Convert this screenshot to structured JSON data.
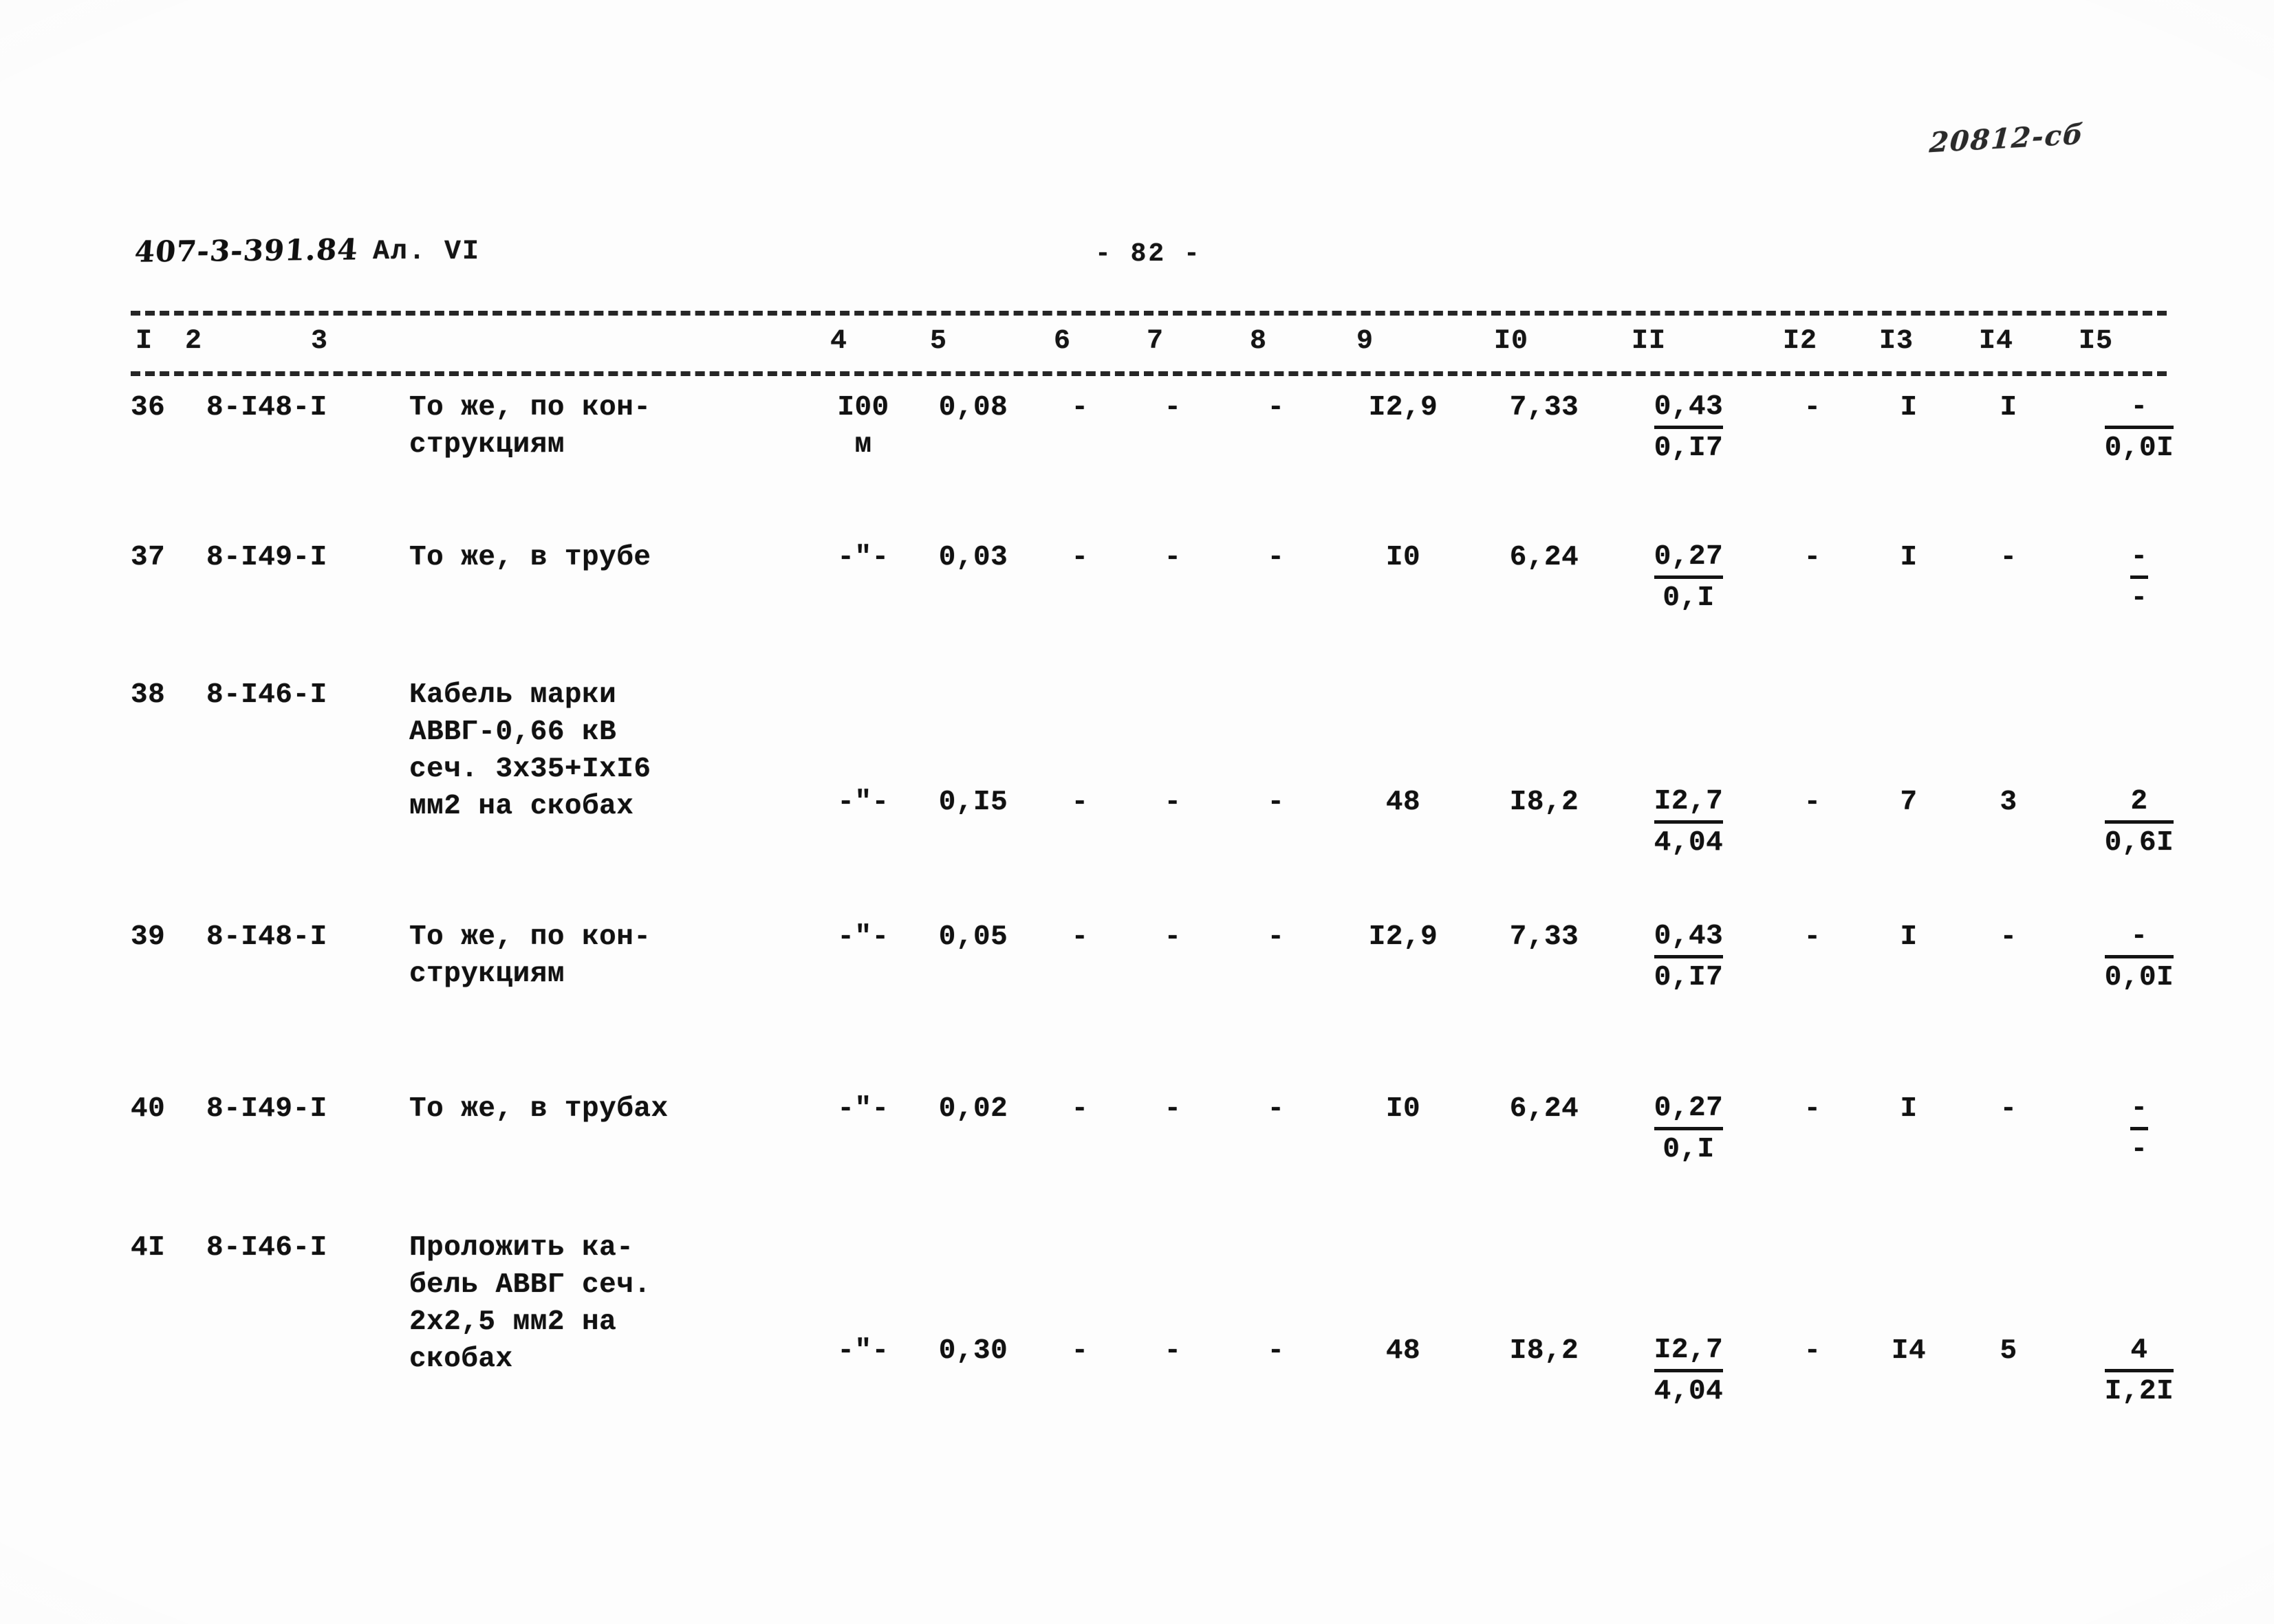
{
  "page": {
    "handwritten_code": "20812-сб",
    "document_code": "407-3-391.84",
    "album_label": "Ал. VI",
    "page_number": "- 82 -"
  },
  "table": {
    "column_numbers": [
      "I",
      "2",
      "3",
      "4",
      "5",
      "6",
      "7",
      "8",
      "9",
      "I0",
      "II",
      "I2",
      "I3",
      "I4",
      "I5"
    ],
    "rows": [
      {
        "num": "36",
        "code": "8-I48-I",
        "desc": "То же, по кон-\nструкциям",
        "unit_top": "I00",
        "unit_bot": "м",
        "c5": "0,08",
        "c6": "-",
        "c7": "-",
        "c8": "-",
        "c9": "I2,9",
        "c10": "7,33",
        "c11_top": "0,43",
        "c11_bot": "0,I7",
        "c12": "-",
        "c13": "I",
        "c14": "I",
        "c15_top": "-",
        "c15_bot": "0,0I"
      },
      {
        "num": "37",
        "code": "8-I49-I",
        "desc": "То же, в трубе",
        "unit_top": "-\"-",
        "unit_bot": "",
        "c5": "0,03",
        "c6": "-",
        "c7": "-",
        "c8": "-",
        "c9": "I0",
        "c10": "6,24",
        "c11_top": "0,27",
        "c11_bot": "0,I",
        "c12": "-",
        "c13": "I",
        "c14": "-",
        "c15_top": "-",
        "c15_bot": "-"
      },
      {
        "num": "38",
        "code": "8-I46-I",
        "desc": "Кабель марки\nАВВГ-0,66 кВ\nсеч. 3х35+IхI6\nмм2 на скобах",
        "unit_top": "-\"-",
        "unit_bot": "",
        "c5": "0,I5",
        "c6": "-",
        "c7": "-",
        "c8": "-",
        "c9": "48",
        "c10": "I8,2",
        "c11_top": "I2,7",
        "c11_bot": "4,04",
        "c12": "-",
        "c13": "7",
        "c14": "3",
        "c15_top": "2",
        "c15_bot": "0,6I"
      },
      {
        "num": "39",
        "code": "8-I48-I",
        "desc": "То же, по кон-\nструкциям",
        "unit_top": "-\"-",
        "unit_bot": "",
        "c5": "0,05",
        "c6": "-",
        "c7": "-",
        "c8": "-",
        "c9": "I2,9",
        "c10": "7,33",
        "c11_top": "0,43",
        "c11_bot": "0,I7",
        "c12": "-",
        "c13": "I",
        "c14": "-",
        "c15_top": "-",
        "c15_bot": "0,0I"
      },
      {
        "num": "40",
        "code": "8-I49-I",
        "desc": "То же, в трубах",
        "unit_top": "-\"-",
        "unit_bot": "",
        "c5": "0,02",
        "c6": "-",
        "c7": "-",
        "c8": "-",
        "c9": "I0",
        "c10": "6,24",
        "c11_top": "0,27",
        "c11_bot": "0,I",
        "c12": "-",
        "c13": "I",
        "c14": "-",
        "c15_top": "-",
        "c15_bot": "-"
      },
      {
        "num": "4I",
        "code": "8-I46-I",
        "desc": "Проложить ка-\nбель АВВГ сеч.\n2х2,5 мм2 на\nскобах",
        "unit_top": "-\"-",
        "unit_bot": "",
        "c5": "0,30",
        "c6": "-",
        "c7": "-",
        "c8": "-",
        "c9": "48",
        "c10": "I8,2",
        "c11_top": "I2,7",
        "c11_bot": "4,04",
        "c12": "-",
        "c13": "I4",
        "c14": "5",
        "c15_top": "4",
        "c15_bot": "I,2I"
      }
    ]
  }
}
